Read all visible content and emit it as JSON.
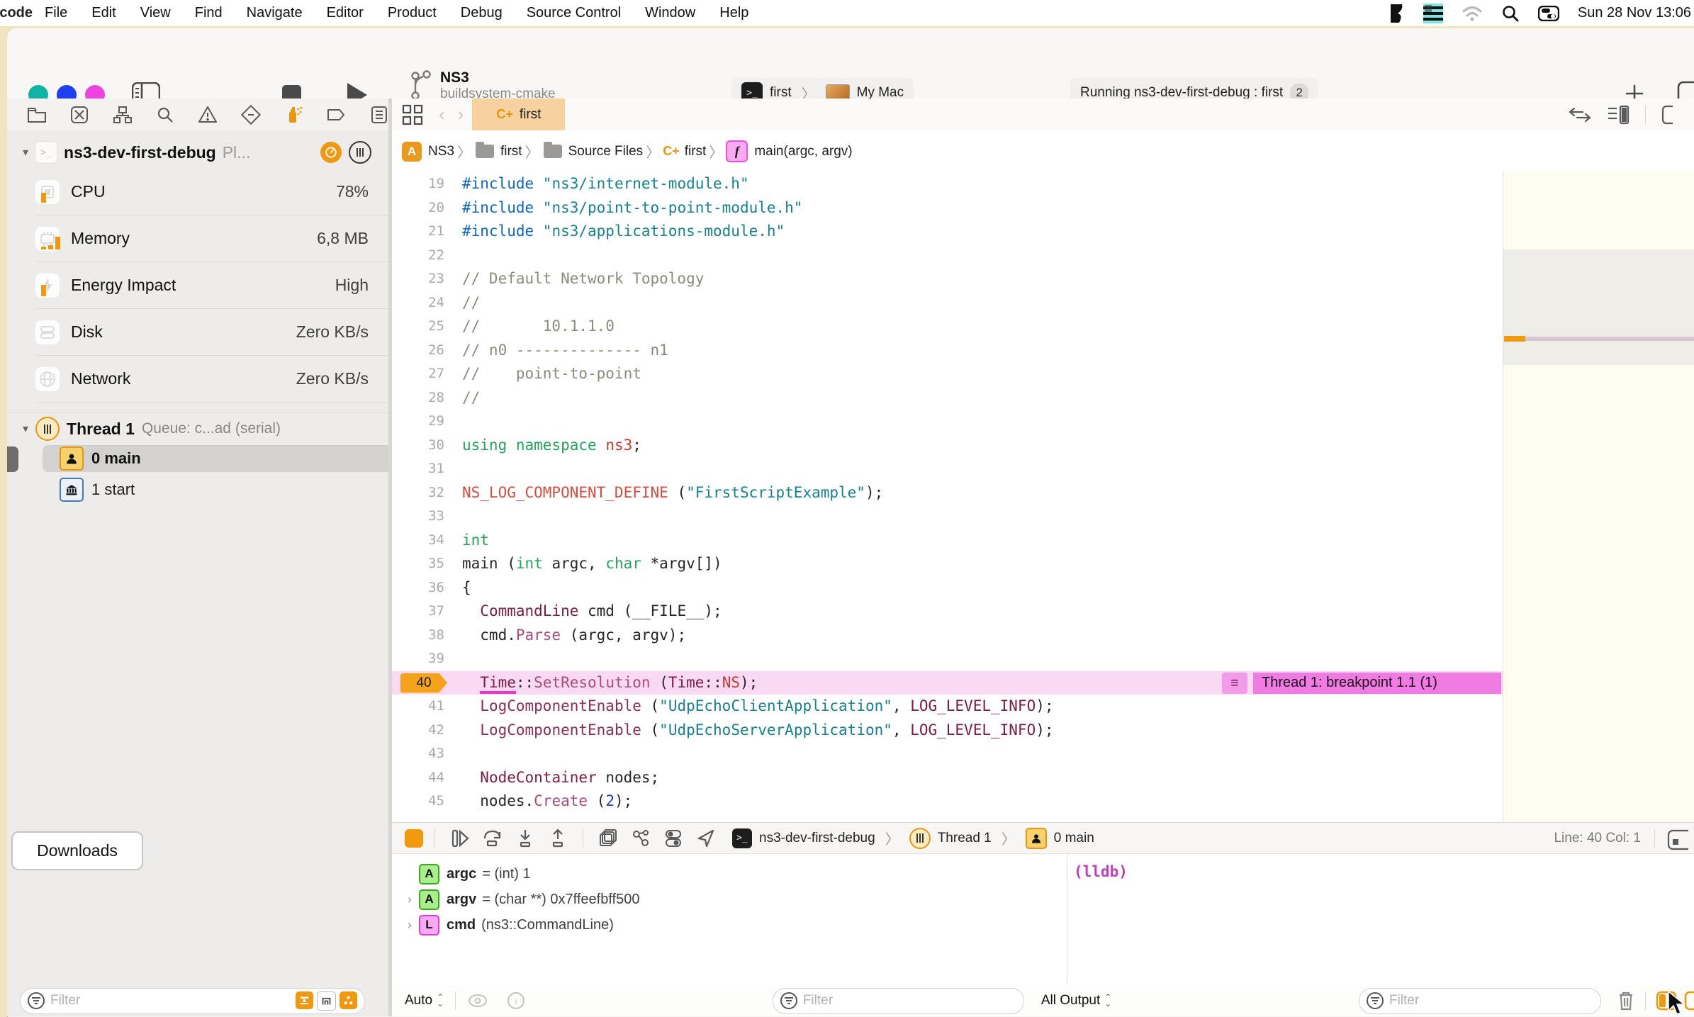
{
  "menu_bar": {
    "app": "Xcode",
    "items": [
      "File",
      "Edit",
      "View",
      "Find",
      "Navigate",
      "Editor",
      "Product",
      "Debug",
      "Source Control",
      "Window",
      "Help"
    ],
    "clock": "Sun 28 Nov  13:06"
  },
  "toolbar": {
    "project_name": "NS3",
    "branch": "buildsystem-cmake",
    "scheme_target": "first",
    "scheme_device": "My Mac",
    "activity_text": "Running ns3-dev-first-debug : first",
    "activity_badge": "2"
  },
  "navigator_icons": [
    "project-navigator-icon",
    "source-control-icon",
    "symbol-navigator-icon",
    "find-navigator-icon",
    "issue-navigator-icon",
    "test-navigator-icon",
    "debug-navigator-icon",
    "breakpoint-navigator-icon",
    "report-navigator-icon"
  ],
  "debug_nav": {
    "process_name": "ns3-dev-first-debug",
    "process_suffix": "Pl...",
    "gauges": [
      {
        "icon": "cpu",
        "label": "CPU",
        "value": "78%",
        "bars": [
          14
        ]
      },
      {
        "icon": "memory",
        "label": "Memory",
        "value": "6,8 MB",
        "bars": [
          4,
          6,
          18
        ]
      },
      {
        "icon": "energy",
        "label": "Energy Impact",
        "value": "High",
        "bars": [
          16
        ]
      },
      {
        "icon": "disk",
        "label": "Disk",
        "value": "Zero KB/s",
        "bars": []
      },
      {
        "icon": "network",
        "label": "Network",
        "value": "Zero KB/s",
        "bars": []
      }
    ],
    "thread_title": "Thread 1",
    "thread_queue": "Queue: c...ad (serial)",
    "frame_0": "0 main",
    "frame_1": "1 start"
  },
  "tab_bar": {
    "active_tab_icon": "C+",
    "active_tab": "first"
  },
  "breadcrumb": {
    "project": "NS3",
    "target": "first",
    "group": "Source Files",
    "file_icon": "C+",
    "file": "first",
    "symbol": "main(argc, argv)"
  },
  "editor": {
    "lines": [
      {
        "n": "19",
        "segs": [
          [
            "#include ",
            "dir"
          ],
          [
            "\"ns3/internet-module.h\"",
            "str"
          ]
        ]
      },
      {
        "n": "20",
        "segs": [
          [
            "#include ",
            "dir"
          ],
          [
            "\"ns3/point-to-point-module.h\"",
            "str"
          ]
        ]
      },
      {
        "n": "21",
        "segs": [
          [
            "#include ",
            "dir"
          ],
          [
            "\"ns3/applications-module.h\"",
            "str"
          ]
        ]
      },
      {
        "n": "22",
        "segs": []
      },
      {
        "n": "23",
        "segs": [
          [
            "// Default Network Topology",
            "cmt"
          ]
        ]
      },
      {
        "n": "24",
        "segs": [
          [
            "//",
            "cmt"
          ]
        ]
      },
      {
        "n": "25",
        "segs": [
          [
            "//       10.1.1.0",
            "cmt"
          ]
        ]
      },
      {
        "n": "26",
        "segs": [
          [
            "// n0 -------------- n1",
            "cmt"
          ]
        ]
      },
      {
        "n": "27",
        "segs": [
          [
            "//    point-to-point",
            "cmt"
          ]
        ]
      },
      {
        "n": "28",
        "segs": [
          [
            "//",
            "cmt"
          ]
        ]
      },
      {
        "n": "29",
        "segs": []
      },
      {
        "n": "30",
        "segs": [
          [
            "using",
            "kw"
          ],
          [
            " ",
            "pl"
          ],
          [
            "namespace",
            "kw"
          ],
          [
            " ",
            "pl"
          ],
          [
            "ns3",
            "red"
          ],
          [
            ";",
            "pl"
          ]
        ]
      },
      {
        "n": "31",
        "segs": []
      },
      {
        "n": "32",
        "segs": [
          [
            "NS_LOG_COMPONENT_DEFINE",
            "macro"
          ],
          [
            " (",
            "pl"
          ],
          [
            "\"FirstScriptExample\"",
            "str"
          ],
          [
            ");",
            "pl"
          ]
        ]
      },
      {
        "n": "33",
        "segs": []
      },
      {
        "n": "34",
        "segs": [
          [
            "int",
            "kw"
          ]
        ]
      },
      {
        "n": "35",
        "segs": [
          [
            "main (",
            "pl"
          ],
          [
            "int",
            "kw"
          ],
          [
            " argc, ",
            "pl"
          ],
          [
            "char",
            "kw"
          ],
          [
            " *argv[])",
            "pl"
          ]
        ]
      },
      {
        "n": "36",
        "segs": [
          [
            "{",
            "pl"
          ]
        ]
      },
      {
        "n": "37",
        "segs": [
          [
            "  ",
            "pl"
          ],
          [
            "CommandLine",
            "type"
          ],
          [
            " cmd (__FILE__);",
            "pl"
          ]
        ]
      },
      {
        "n": "38",
        "segs": [
          [
            "  cmd.",
            "pl"
          ],
          [
            "Parse",
            "fn"
          ],
          [
            " (argc, argv);",
            "pl"
          ]
        ]
      },
      {
        "n": "39",
        "segs": []
      },
      {
        "n": "40",
        "bp": true,
        "segs": [
          [
            "  ",
            "pl"
          ],
          [
            "Time",
            "type u"
          ],
          [
            "::",
            "pl"
          ],
          [
            "SetResolution",
            "fn"
          ],
          [
            " (",
            "pl"
          ],
          [
            "Time",
            "type"
          ],
          [
            "::",
            "pl"
          ],
          [
            "NS",
            "red"
          ],
          [
            ");",
            "pl"
          ]
        ]
      },
      {
        "n": "41",
        "segs": [
          [
            "  ",
            "pl"
          ],
          [
            "LogComponentEnable",
            "fn2"
          ],
          [
            " (",
            "pl"
          ],
          [
            "\"UdpEchoClientApplication\"",
            "str"
          ],
          [
            ", ",
            "pl"
          ],
          [
            "LOG_LEVEL_INFO",
            "type"
          ],
          [
            ");",
            "pl"
          ]
        ]
      },
      {
        "n": "42",
        "segs": [
          [
            "  ",
            "pl"
          ],
          [
            "LogComponentEnable",
            "fn2"
          ],
          [
            " (",
            "pl"
          ],
          [
            "\"UdpEchoServerApplication\"",
            "str"
          ],
          [
            ", ",
            "pl"
          ],
          [
            "LOG_LEVEL_INFO",
            "type"
          ],
          [
            ");",
            "pl"
          ]
        ]
      },
      {
        "n": "43",
        "segs": []
      },
      {
        "n": "44",
        "segs": [
          [
            "  ",
            "pl"
          ],
          [
            "NodeContainer",
            "type"
          ],
          [
            " nodes;",
            "pl"
          ]
        ]
      },
      {
        "n": "45",
        "segs": [
          [
            "  nodes.",
            "pl"
          ],
          [
            "Create",
            "fn"
          ],
          [
            " (",
            "pl"
          ],
          [
            "2",
            "num2"
          ],
          [
            ");",
            "pl"
          ]
        ]
      }
    ],
    "breakpoint_line": "40",
    "breakpoint_menu_glyph": "≡",
    "breakpoint_tag": "Thread 1: breakpoint 1.1 (1)"
  },
  "debug_bar": {
    "jump_process": "ns3-dev-first-debug",
    "jump_thread": "Thread 1",
    "jump_frame": "0 main",
    "line_col": "Line: 40  Col: 1"
  },
  "variables": [
    {
      "badge": "A",
      "color": "green",
      "expandable": false,
      "name": "argc",
      "value": "= (int) 1"
    },
    {
      "badge": "A",
      "color": "green",
      "expandable": true,
      "name": "argv",
      "value": "= (char **) 0x7ffeefbff500"
    },
    {
      "badge": "L",
      "color": "pink",
      "expandable": true,
      "name": "cmd",
      "value": "(ns3::CommandLine)"
    }
  ],
  "console": {
    "prompt": "(lldb)"
  },
  "bottom": {
    "downloads_label": "Downloads",
    "filter_placeholder": "Filter",
    "auto_label": "Auto",
    "output_label": "All Output"
  },
  "colors": {
    "accent_orange": "#F0980E",
    "breakpoint_row": "#FAD9F2",
    "breakpoint_tag": "#F07BE3",
    "tab_selected": "#F6D39E",
    "traffic_teal": "#0FB4A4",
    "traffic_blue": "#1E40F2",
    "traffic_magenta": "#EF42DF",
    "lldb_prompt": "#C03BBE"
  }
}
